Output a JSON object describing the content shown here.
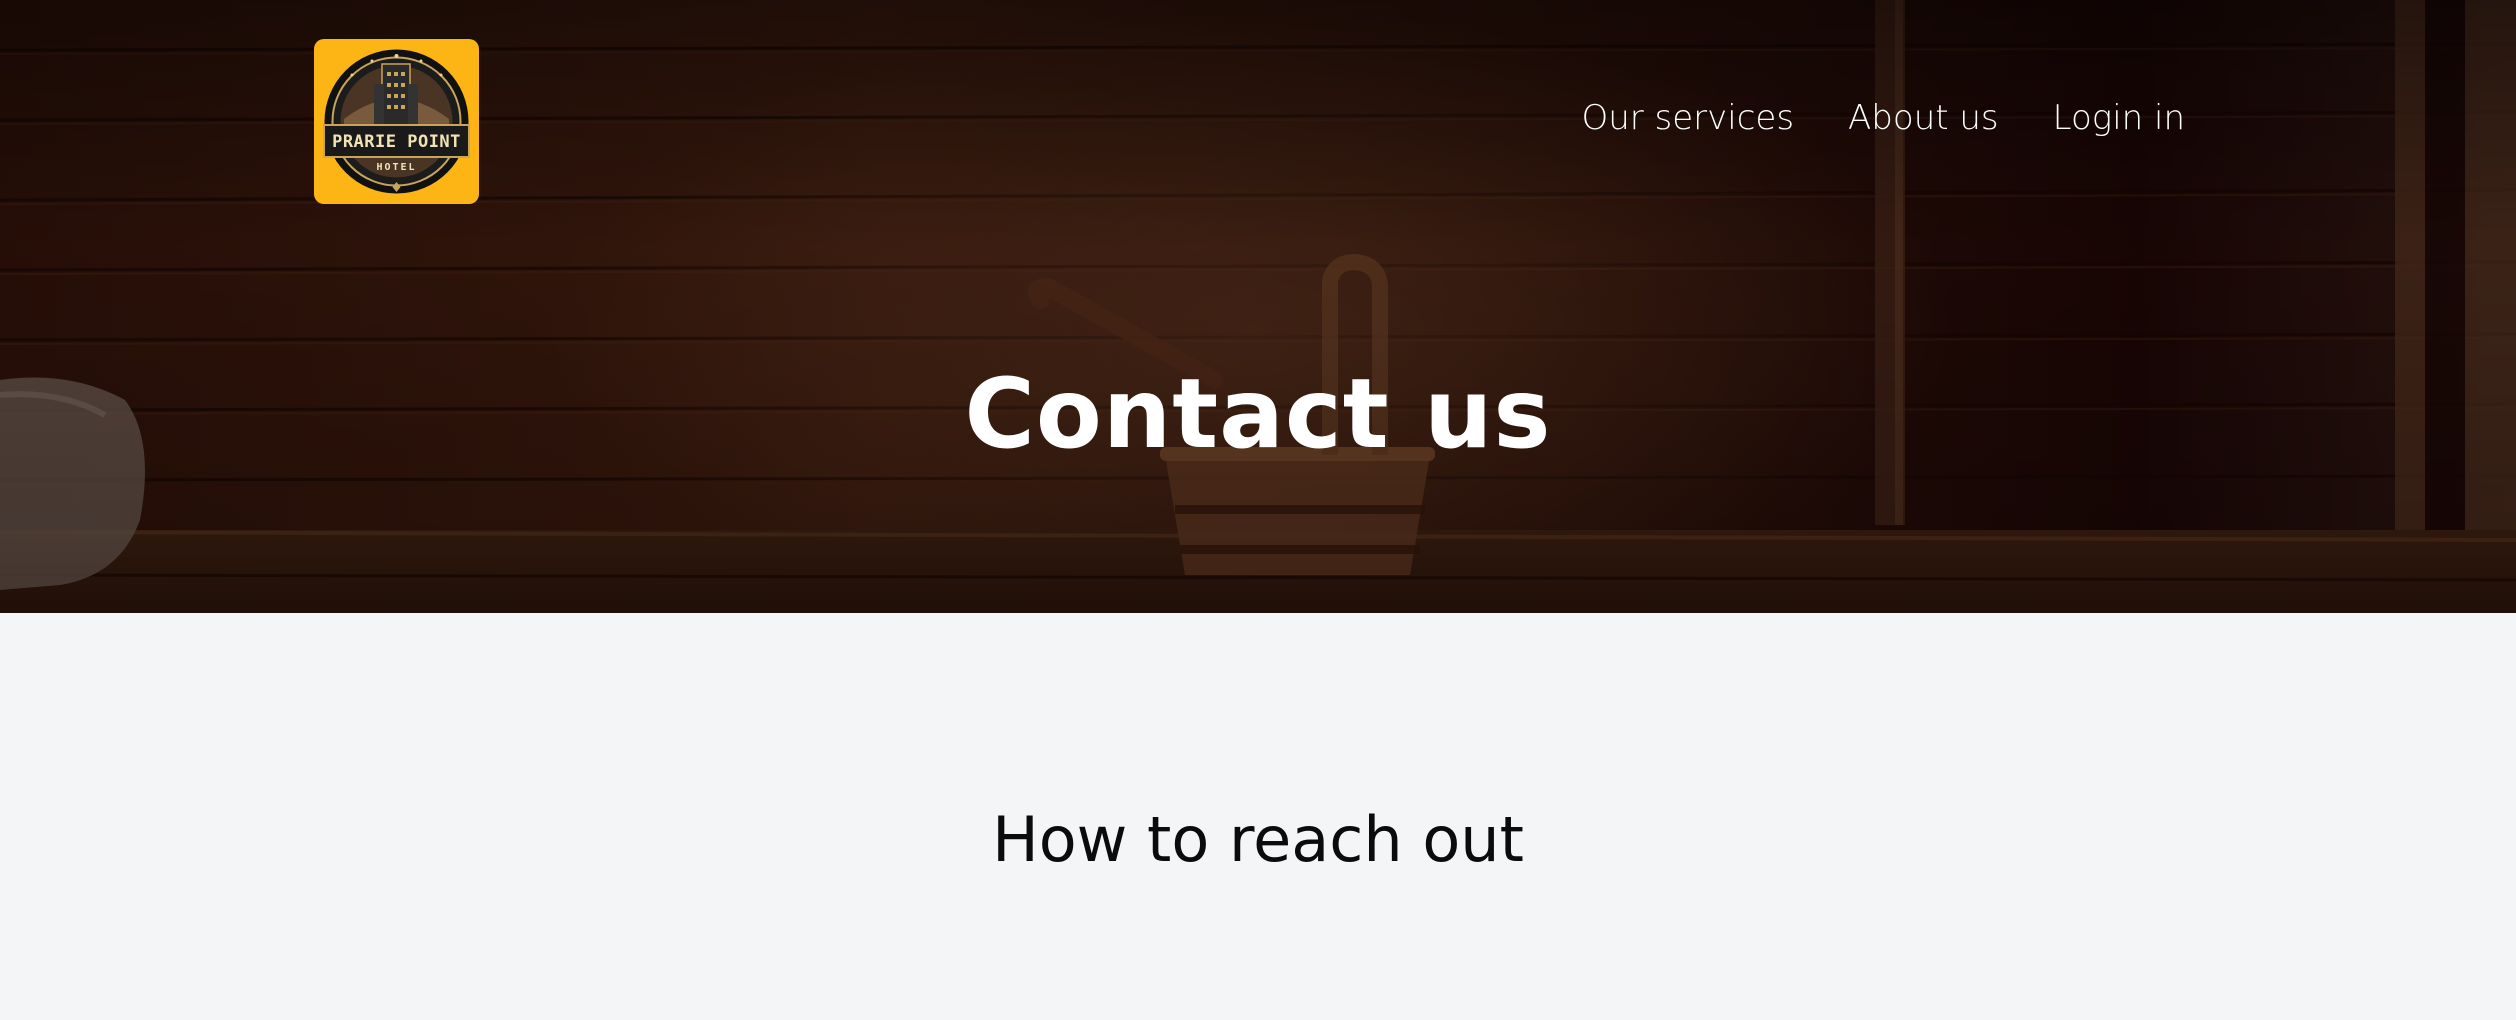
{
  "brand": {
    "name": "PRARIE POINT",
    "subtitle": "HOTEL",
    "badge_color": "#fdb515"
  },
  "nav": {
    "items": [
      {
        "label": "Our services",
        "icon": null
      },
      {
        "label": "About us",
        "icon": null
      },
      {
        "label": "Login in",
        "icon": null
      }
    ]
  },
  "hero": {
    "title": "Contact us",
    "background": "dark wooden sauna interior with bucket and towel"
  },
  "contact_section": {
    "heading": "How to reach out",
    "background_color": "#f4f5f7"
  }
}
